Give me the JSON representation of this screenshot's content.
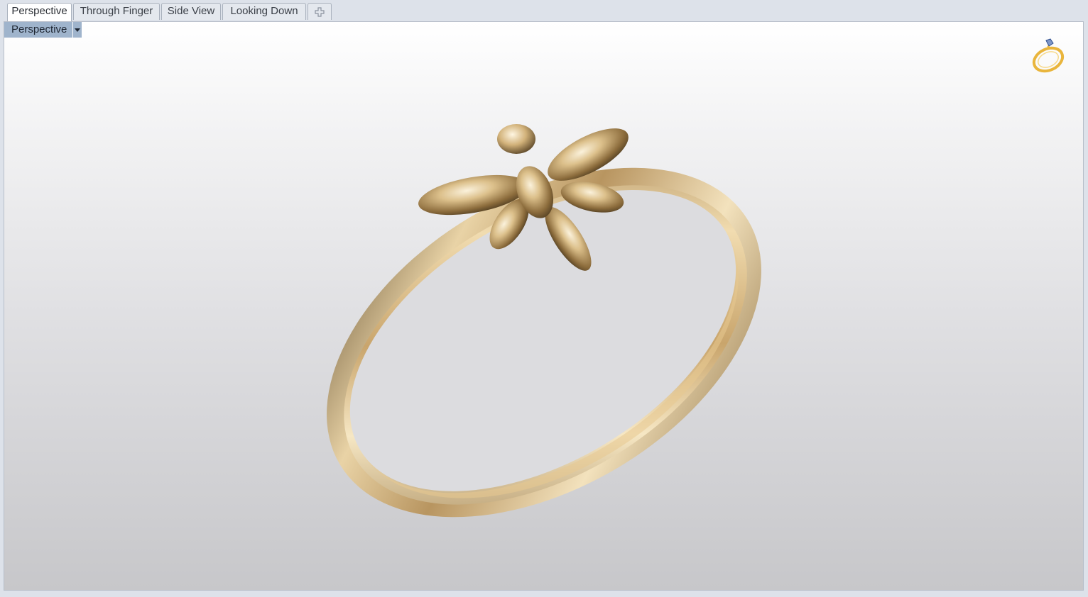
{
  "tabs": [
    {
      "label": "Perspective",
      "active": true
    },
    {
      "label": "Through Finger",
      "active": false
    },
    {
      "label": "Side View",
      "active": false
    },
    {
      "label": "Looking Down",
      "active": false
    }
  ],
  "add_tab_icon": "plus-icon",
  "viewport": {
    "label": "Perspective",
    "dropdown_icon": "chevron-down-icon",
    "corner_icon": "ring-icon",
    "model": "gold ring with dragonfly"
  },
  "colors": {
    "viewport_label_bg": "#9fb4cc",
    "gold": "#d9b77c"
  }
}
